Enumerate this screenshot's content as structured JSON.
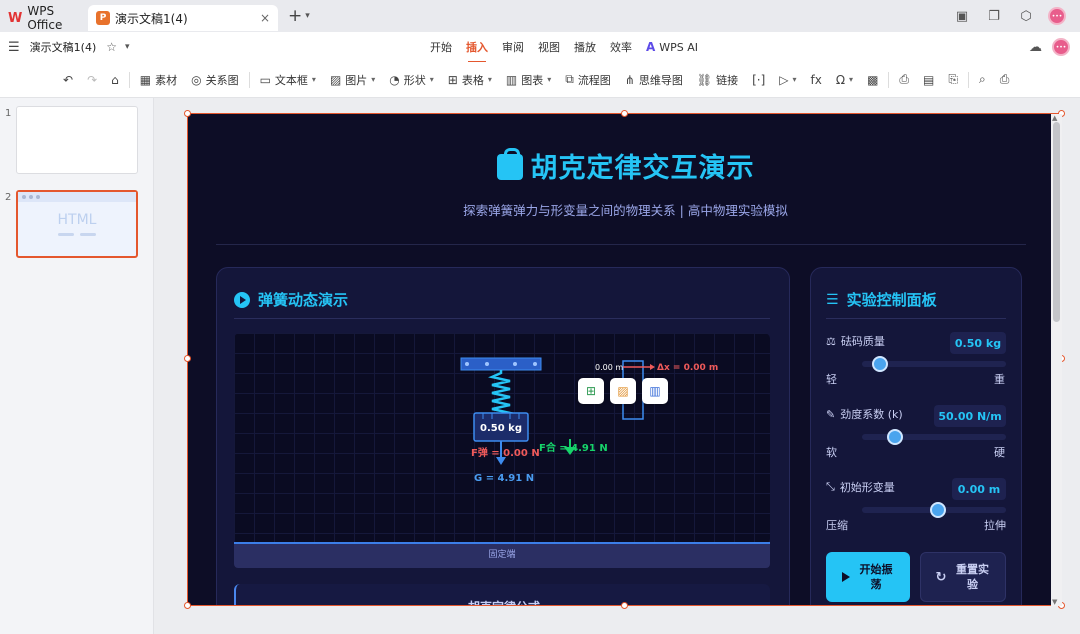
{
  "titlebar": {
    "wps_tab": "WPS Office",
    "doc_tab": "演示文稿1(4)",
    "close": "×",
    "new_tab": "+"
  },
  "menubar": {
    "file_name": "演示文稿1(4)",
    "tabs": [
      "开始",
      "插入",
      "审阅",
      "视图",
      "播放",
      "效率"
    ],
    "active_tab": "插入",
    "wps_ai": "WPS AI"
  },
  "toolbar": {
    "items": [
      "素材",
      "关系图",
      "文本框",
      "图片",
      "形状",
      "表格",
      "图表",
      "流程图",
      "思维导图",
      "链接"
    ]
  },
  "thumbnails": {
    "numbers": [
      "1",
      "2"
    ],
    "html_label": "HTML"
  },
  "slide": {
    "title": "胡克定律交互演示",
    "subtitle": "探索弹簧弹力与形变量之间的物理关系 | 高中物理实验模拟",
    "demo_card": {
      "title": "弹簧动态演示",
      "mass_label": "0.50 kg",
      "f_spring": "F弹 = 0.00 N",
      "f_net": "F合 = 4.91 N",
      "gravity": "G = 4.91 N",
      "ruler_zero": "0.00 m",
      "delta_x": "Δx = 0.00 m",
      "ground": "固定端",
      "formula_title": "胡克定律公式"
    },
    "control_card": {
      "title": "实验控制面板",
      "mass": {
        "label": "砝码质量",
        "value": "0.50 kg",
        "min": "轻",
        "max": "重",
        "level": 0.1
      },
      "stiffness": {
        "label": "劲度系数 (k)",
        "value": "50.00 N/m",
        "min": "软",
        "max": "硬",
        "level": 0.2
      },
      "deform": {
        "label": "初始形变量",
        "value": "0.00 m",
        "min": "压缩",
        "max": "拉伸",
        "level": 0.5
      },
      "start_button": "开始振荡",
      "reset_button": "重置实验"
    }
  }
}
